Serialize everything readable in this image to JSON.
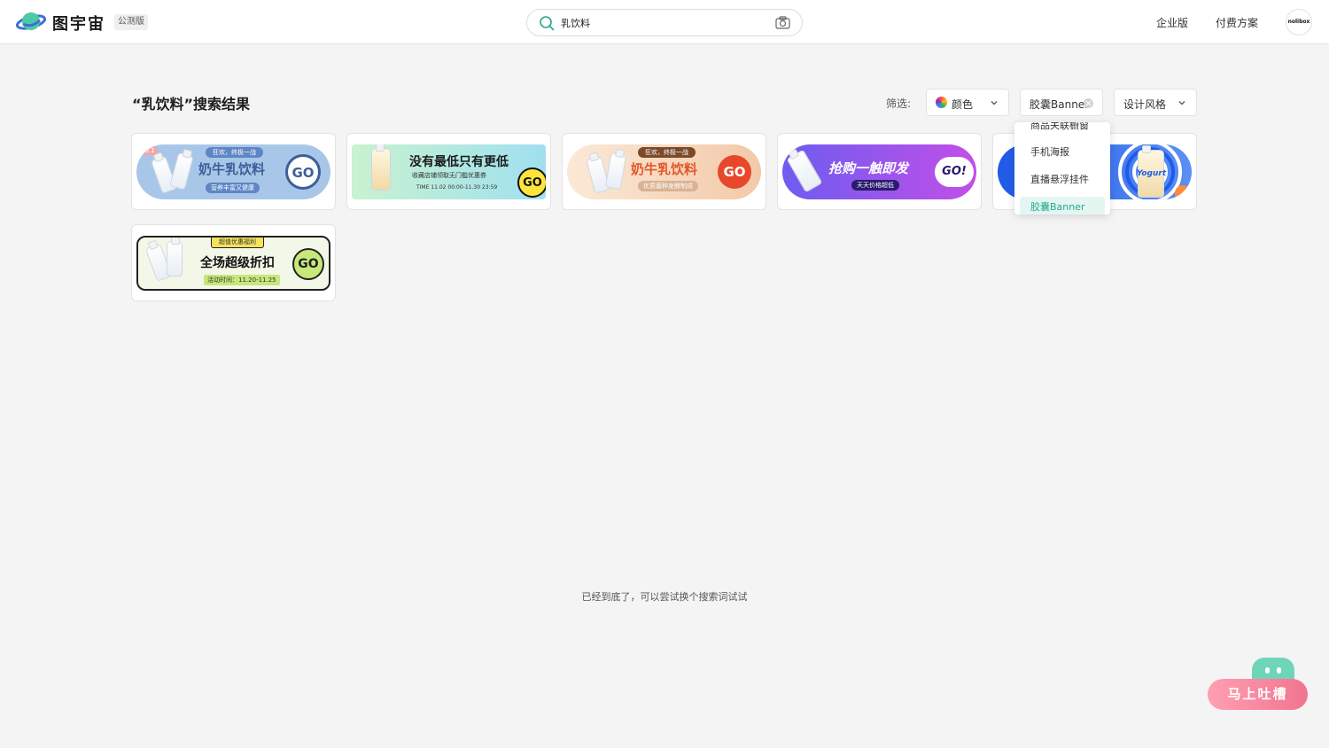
{
  "header": {
    "brand": "图宇宙",
    "badge": "公测版",
    "search": {
      "value": "乳饮料"
    },
    "nav": [
      "企业版",
      "付费方案"
    ],
    "avatar_text": "nolibox"
  },
  "results": {
    "title": "“乳饮料”搜索结果",
    "filter_label": "筛选:",
    "filters": {
      "color": "颜色",
      "type": "胶囊Banner",
      "style": "设计风格"
    },
    "end_text": "已经到底了，可以尝试换个搜索词试试"
  },
  "dropdown": {
    "items": [
      "商品关联橱窗",
      "手机海报",
      "直播悬浮挂件",
      "胶囊Banner"
    ],
    "selected": "胶囊Banner"
  },
  "cards": [
    {
      "top": "狂欢，终极一战",
      "main": "奶牛乳饮料",
      "sub": "营养丰富又健康",
      "go": "GO",
      "tag": "10.1"
    },
    {
      "main": "没有最低只有更低",
      "sub": "收藏店铺领取无门槛优惠券",
      "time": "TIME 11.02 00:00-11.30 23:59",
      "go": "GO"
    },
    {
      "top": "狂欢，终极一战",
      "main": "奶牛乳饮料",
      "sub": "优质菌种发酵制成",
      "go": "GO"
    },
    {
      "main": "抢购一触即发",
      "sub": "天天价格超低",
      "go": "GO!"
    },
    {
      "bottle_label": "Yogurt"
    },
    {
      "top": "超值优惠福利",
      "main": "全场超级折扣",
      "sub": "活动时间：11.20-11.25",
      "go": "GO"
    }
  ],
  "feedback": {
    "label": "马上吐槽"
  },
  "colors": {
    "accent": "#2aa58a",
    "selected_bg": "#e3f6f2",
    "feedback": "#f1748f"
  }
}
